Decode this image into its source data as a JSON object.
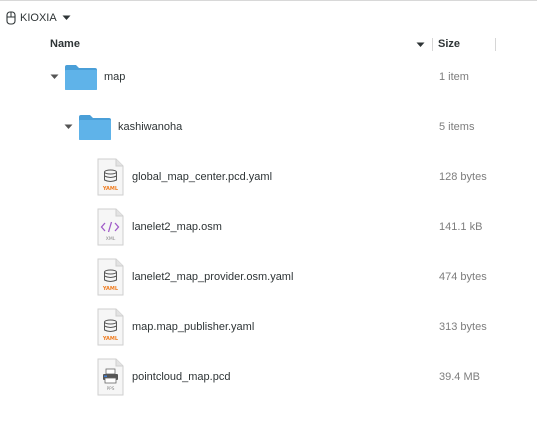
{
  "location": {
    "drive_label": "KIOXIA"
  },
  "columns": {
    "name": "Name",
    "size": "Size"
  },
  "rows": [
    {
      "name": "map",
      "size": "1 item",
      "type": "folder",
      "expanded": true,
      "icon": "folder-icon"
    },
    {
      "name": "kashiwanoha",
      "size": "5 items",
      "type": "folder",
      "expanded": true,
      "icon": "folder-icon"
    },
    {
      "name": "global_map_center.pcd.yaml",
      "size": "128 bytes",
      "type": "yaml",
      "icon": "yaml-file-icon"
    },
    {
      "name": "lanelet2_map.osm",
      "size": "141.1 kB",
      "type": "xml",
      "icon": "xml-file-icon"
    },
    {
      "name": "lanelet2_map_provider.osm.yaml",
      "size": "474 bytes",
      "type": "yaml",
      "icon": "yaml-file-icon"
    },
    {
      "name": "map.map_publisher.yaml",
      "size": "313 bytes",
      "type": "yaml",
      "icon": "yaml-file-icon"
    },
    {
      "name": "pointcloud_map.pcd",
      "size": "39.4 MB",
      "type": "pcd",
      "icon": "pcd-file-icon"
    }
  ],
  "icon_labels": {
    "yaml": "YAML",
    "xml": "XML",
    "pcd": "PPS"
  },
  "colors": {
    "folder": "#5fb3e9",
    "folder_dark": "#4a9fd8",
    "yaml_accent": "#f07c1f",
    "xml_accent": "#a05cc8",
    "text": "#2e3436",
    "secondary_text": "#7d7d7d"
  }
}
